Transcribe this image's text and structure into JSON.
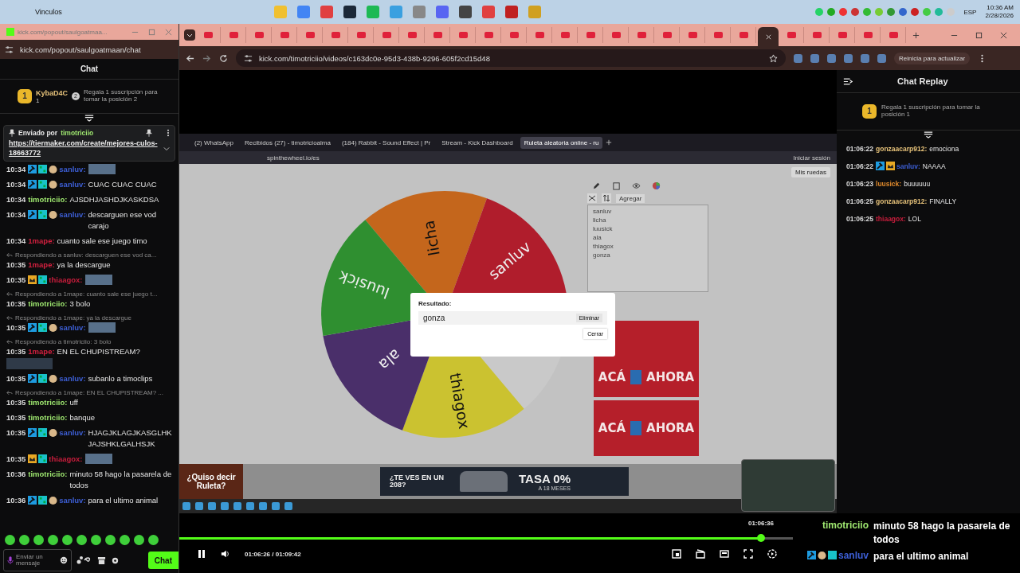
{
  "taskbar": {
    "title": "Vinculos",
    "language": "ESP",
    "time": "10:36 AM",
    "date": "2/28/2026"
  },
  "popout": {
    "tab_title": "kick.com/popout/saulgoatmaa...",
    "url": "kick.com/popout/saulgoatmaan/chat",
    "header": "Chat",
    "leader": {
      "rank": "1",
      "name": "KybaD4C",
      "count": "1",
      "next_rank": "2",
      "promo": "Regala 1 suscripción para tomar la posición 2"
    },
    "pinned": {
      "label": "Enviado por",
      "user": "timotriciio",
      "link": "https://tiermaker.com/create/mejores-culos-18663772"
    },
    "messages": [
      {
        "time": "10:34",
        "badges": [
          {
            "kind": "mod"
          },
          {
            "kind": "og"
          },
          {
            "kind": "sub"
          }
        ],
        "user": "sanluv:",
        "color": "#3d5fd6",
        "image": {
          "kind": "inline"
        }
      },
      {
        "time": "10:34",
        "badges": [
          {
            "kind": "mod"
          },
          {
            "kind": "og"
          },
          {
            "kind": "sub"
          }
        ],
        "user": "sanluv:",
        "color": "#3d5fd6",
        "text": "CUAC CUAC CUAC"
      },
      {
        "time": "10:34",
        "user": "timotriciio:",
        "color": "#9fe870",
        "text": "AJSDHJASHDJKASKDSA"
      },
      {
        "time": "10:34",
        "badges": [
          {
            "kind": "mod"
          },
          {
            "kind": "og"
          },
          {
            "kind": "sub"
          }
        ],
        "user": "sanluv:",
        "color": "#3d5fd6",
        "text": "descarguen ese vod carajo"
      },
      {
        "time": "10:34",
        "user": "1mape:",
        "color": "#d4203f",
        "text": "cuanto sale ese juego timo"
      },
      {
        "reply": "Respondiendo a sanluv: descarguen ese vod ca...",
        "time": "10:35",
        "user": "1mape:",
        "color": "#d4203f",
        "text": "ya la descargue"
      },
      {
        "time": "10:35",
        "badges": [
          {
            "kind": "crown"
          },
          {
            "kind": "og"
          }
        ],
        "user": "thiaagox:",
        "color": "#c81d3c",
        "image": {
          "kind": "inline"
        }
      },
      {
        "reply": "Respondiendo a 1mape: cuanto sale ese juego t...",
        "time": "10:35",
        "user": "timotriciio:",
        "color": "#9fe870",
        "text": "3 bolo"
      },
      {
        "reply": "Respondiendo a 1mape: ya la descargue",
        "time": "10:35",
        "badges": [
          {
            "kind": "mod"
          },
          {
            "kind": "og"
          },
          {
            "kind": "sub"
          }
        ],
        "user": "sanluv:",
        "color": "#3d5fd6",
        "image": {
          "kind": "inline"
        }
      },
      {
        "reply": "Respondiendo a timotriciio: 3 bolo",
        "time": "10:35",
        "user": "1mape:",
        "color": "#d4203f",
        "text": "EN EL CHUPISTREAM?",
        "image": {
          "kind": "below"
        }
      },
      {
        "time": "10:35",
        "badges": [
          {
            "kind": "mod"
          },
          {
            "kind": "og"
          },
          {
            "kind": "sub"
          }
        ],
        "user": "sanluv:",
        "color": "#3d5fd6",
        "text": "subanlo a timoclips"
      },
      {
        "reply": "Respondiendo a 1mape: EN EL CHUPISTREAM? ...",
        "time": "10:35",
        "user": "timotriciio:",
        "color": "#9fe870",
        "text": "uff"
      },
      {
        "time": "10:35",
        "user": "timotriciio:",
        "color": "#9fe870",
        "text": "banque"
      },
      {
        "time": "10:35",
        "badges": [
          {
            "kind": "mod"
          },
          {
            "kind": "og"
          },
          {
            "kind": "sub"
          }
        ],
        "user": "sanluv:",
        "color": "#3d5fd6",
        "text": "HJAGJKLAGJKASGLHKJAJSHKLGALHSJK"
      },
      {
        "time": "10:35",
        "badges": [
          {
            "kind": "crown"
          },
          {
            "kind": "og"
          }
        ],
        "user": "thiaagox:",
        "color": "#c81d3c",
        "image": {
          "kind": "inline"
        }
      },
      {
        "time": "10:36",
        "user": "timotriciio:",
        "color": "#9fe870",
        "text": "minuto 58 hago la pasarela de todos"
      },
      {
        "time": "10:36",
        "badges": [
          {
            "kind": "mod"
          },
          {
            "kind": "og"
          },
          {
            "kind": "sub"
          }
        ],
        "user": "sanluv:",
        "color": "#3d5fd6",
        "text": "para el ultimo animal"
      }
    ],
    "input": {
      "placeholder": "Enviar un mensaje",
      "send": "Chat"
    }
  },
  "browser": {
    "url": "kick.com/timotriciio/videos/c163dc0e-95d3-438b-9296-605f2cd15d48",
    "update": "Reinicia para actualizar"
  },
  "stream": {
    "tabs": [
      {
        "label": "(2) WhatsApp",
        "selected": false
      },
      {
        "label": "Recibidos (27) - timotricioalma",
        "selected": false
      },
      {
        "label": "(184) Rabbit - Sound Effect | Pr",
        "selected": false
      },
      {
        "label": "Stream - Kick Dashboard",
        "selected": false
      },
      {
        "label": "Ruleta aleatoria online - ru",
        "selected": true
      }
    ],
    "url": "spinthewheel.io/es",
    "sign_in": "Iniciar sesión",
    "my_wheels": "Mis ruedas",
    "add": "Agregar",
    "entries": [
      "sanluv",
      "licha",
      "luusick",
      "ala",
      "thiagox",
      "gonza"
    ],
    "slices": [
      {
        "label": "licha",
        "color": "#c4661c"
      },
      {
        "label": "sanluv",
        "color": "#b01d2c"
      },
      {
        "color": "#c9c9c9"
      },
      {
        "label": "thiagox",
        "color": "#cbc230"
      },
      {
        "label": "ala",
        "color": "#4a2f6a"
      },
      {
        "label": "luusick",
        "color": "#2f8f30"
      }
    ],
    "result": {
      "title": "Resultado:",
      "value": "gonza",
      "remove": "Eliminar",
      "close": "Cerrar"
    },
    "banners": [
      {
        "left": "ACÁ",
        "right": "AHORA"
      },
      {
        "left": "ACÁ",
        "right": "AHORA"
      }
    ],
    "ads": {
      "suggest": "¿Quiso decir Ruleta?",
      "car_question": "¿TE VES EN UN 208?",
      "rate": "TASA 0%",
      "months": "A 18 MESES"
    }
  },
  "player": {
    "playing": true,
    "level": 0.948,
    "hover_time": "01:06:36",
    "time": "01:06:26 / 01:09:42"
  },
  "replay": {
    "title": "Chat Replay",
    "rank": "1",
    "promo": "Regala 1 suscripción para tomar la posición 1",
    "messages": [
      {
        "time": "01:06:22",
        "user": "gonzaacarp912:",
        "color": "#e6c27a",
        "text": "emociona"
      },
      {
        "time": "01:06:22",
        "badges": [
          {
            "kind": "mod"
          },
          {
            "kind": "crown"
          }
        ],
        "user": "sanluv:",
        "color": "#3d5fd6",
        "text": "NAAAA"
      },
      {
        "time": "01:06:23",
        "user": "luusick:",
        "color": "#e08a2c",
        "text": "buuuuuu"
      },
      {
        "time": "01:06:25",
        "user": "gonzaacarp912:",
        "color": "#e6c27a",
        "text": "FINALLY"
      },
      {
        "time": "01:06:25",
        "user": "thiaagox:",
        "color": "#c81d3c",
        "text": "LOL"
      }
    ]
  },
  "overlay": [
    {
      "user": "timotriciio",
      "color": "#9fe870",
      "text": "minuto 58 hago la pasarela de todos"
    },
    {
      "badges": [
        {
          "kind": "mod"
        },
        {
          "kind": "sub"
        },
        {
          "kind": "og"
        }
      ],
      "user": "sanluv",
      "color": "#3d5fd6",
      "text": "para el ultimo animal"
    }
  ]
}
